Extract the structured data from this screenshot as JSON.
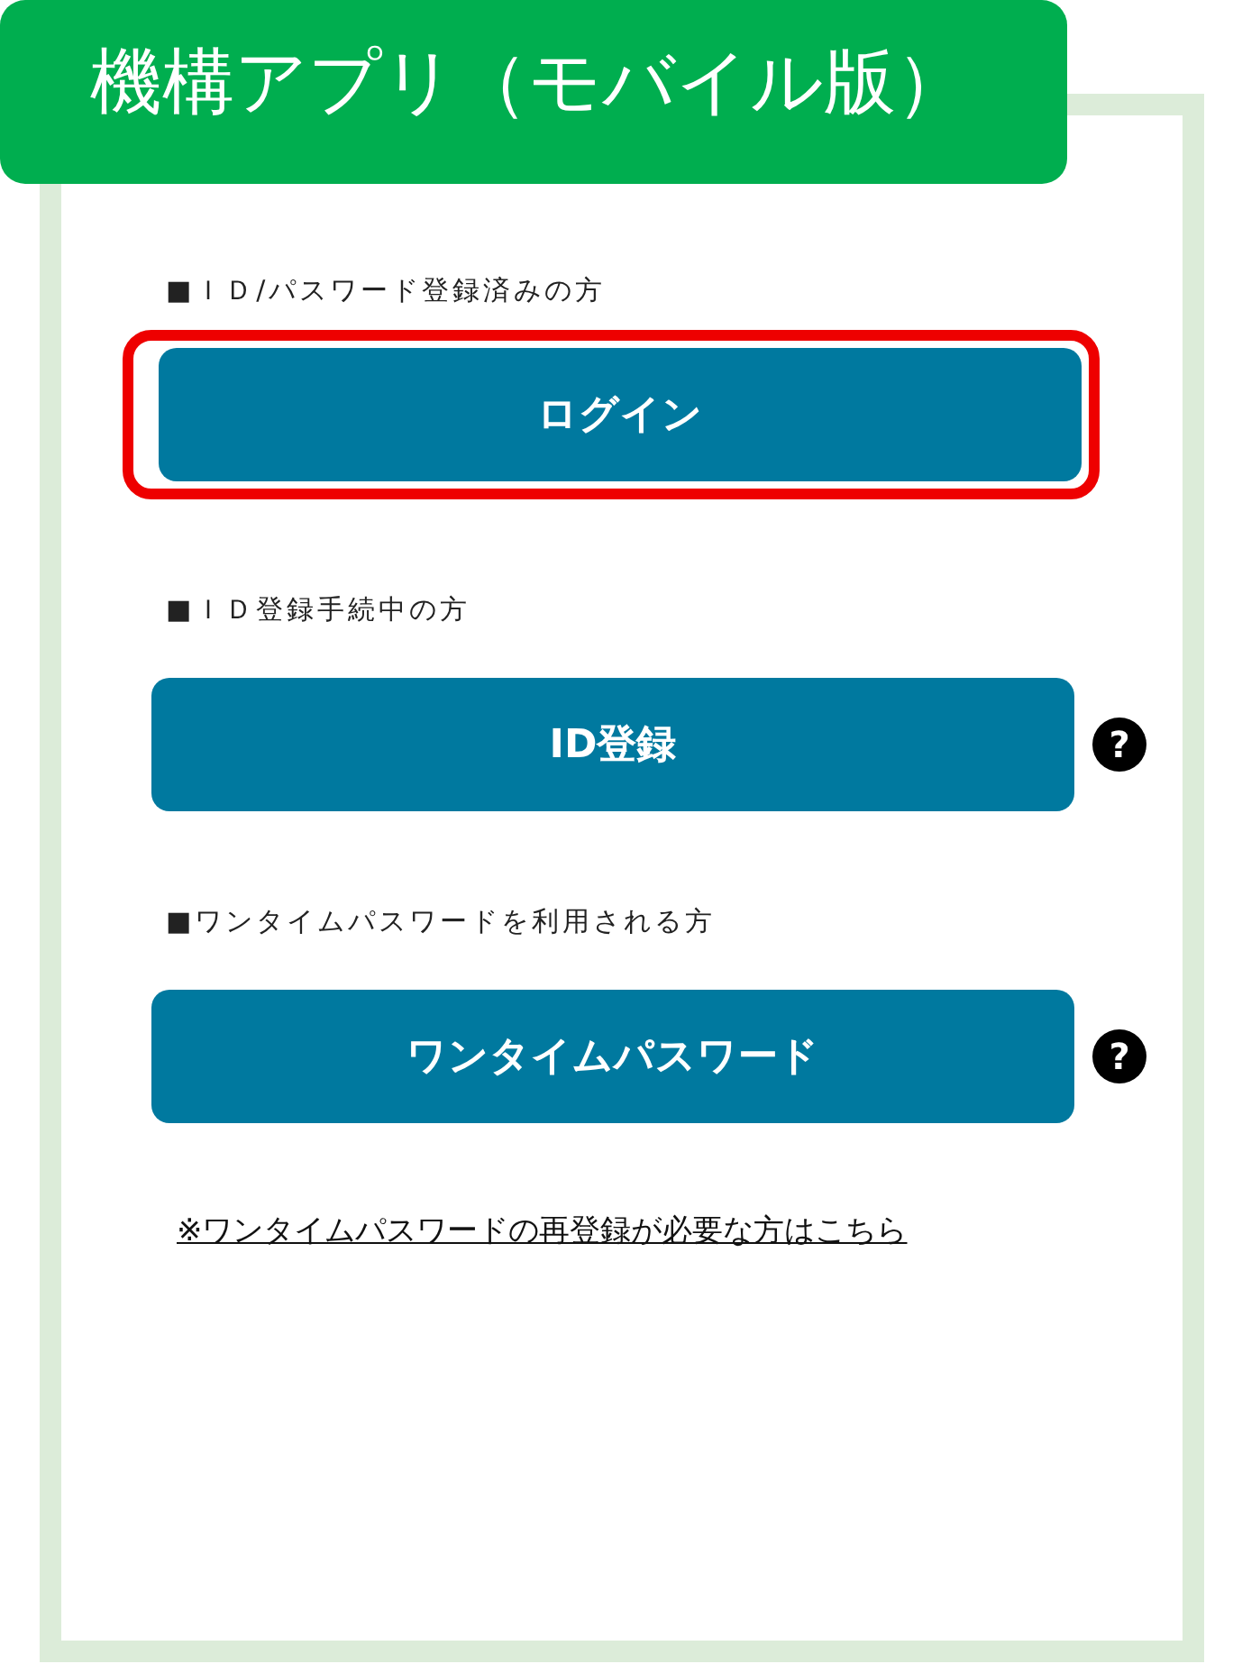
{
  "header": {
    "title": "機構アプリ（モバイル版）"
  },
  "sections": [
    {
      "heading": "■ＩＤ/パスワード登録済みの方",
      "button": "ログイン",
      "highlighted": true
    },
    {
      "heading": "■ＩＤ登録手続中の方",
      "button": "ID登録",
      "highlighted": false,
      "help": "?"
    },
    {
      "heading": "■ワンタイムパスワードを利用される方",
      "button": "ワンタイムパスワード",
      "highlighted": false,
      "help": "?"
    }
  ],
  "link": "※ワンタイムパスワードの再登録が必要な方はこちら"
}
